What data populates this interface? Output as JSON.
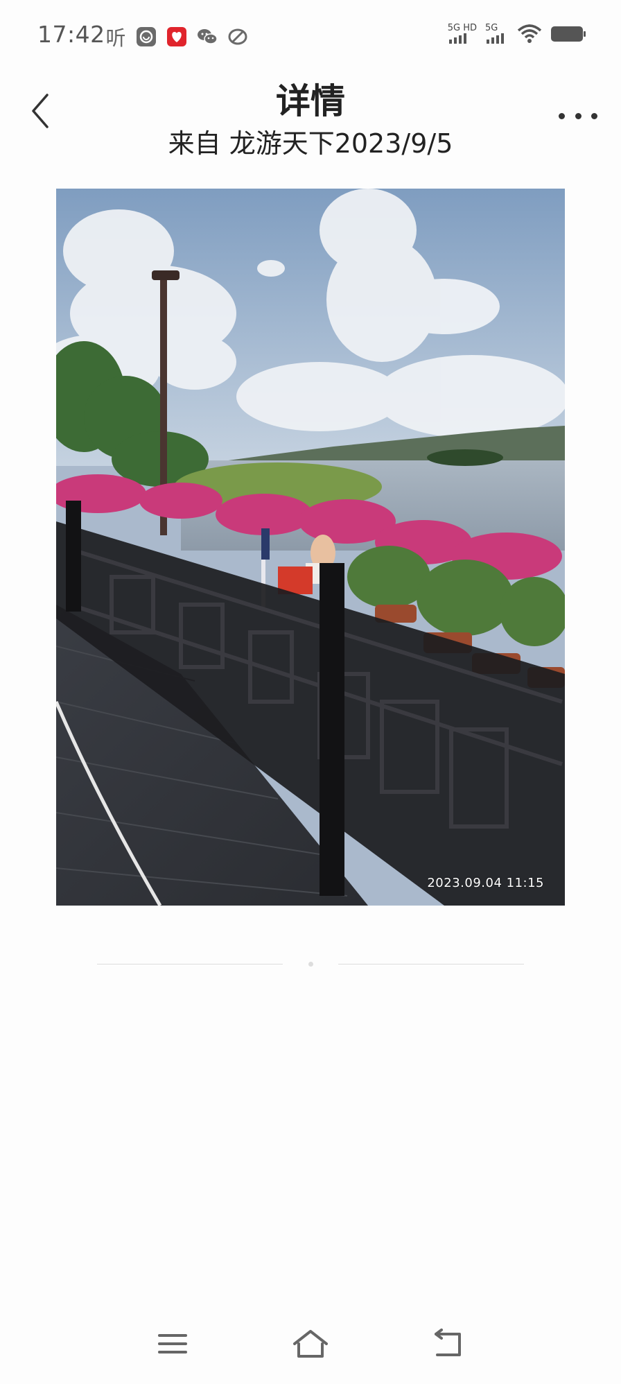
{
  "status_bar": {
    "time": "17:42",
    "listen_label": "听",
    "network_labels": [
      "5G HD",
      "5G"
    ],
    "app_icons": [
      "browser-icon",
      "love-icon",
      "wechat-icon",
      "loop-icon"
    ]
  },
  "header": {
    "title": "详情",
    "subtitle": "来自 龙游天下2023/9/5"
  },
  "photo": {
    "timestamp": "2023.09.04 11:15"
  },
  "nav_bar": {
    "icons": [
      "menu-icon",
      "home-icon",
      "back-arrow-icon"
    ]
  },
  "colors": {
    "background": "#fdfdfd",
    "text": "#222222",
    "icon": "#555555",
    "love_icon_red": "#e0242c"
  }
}
